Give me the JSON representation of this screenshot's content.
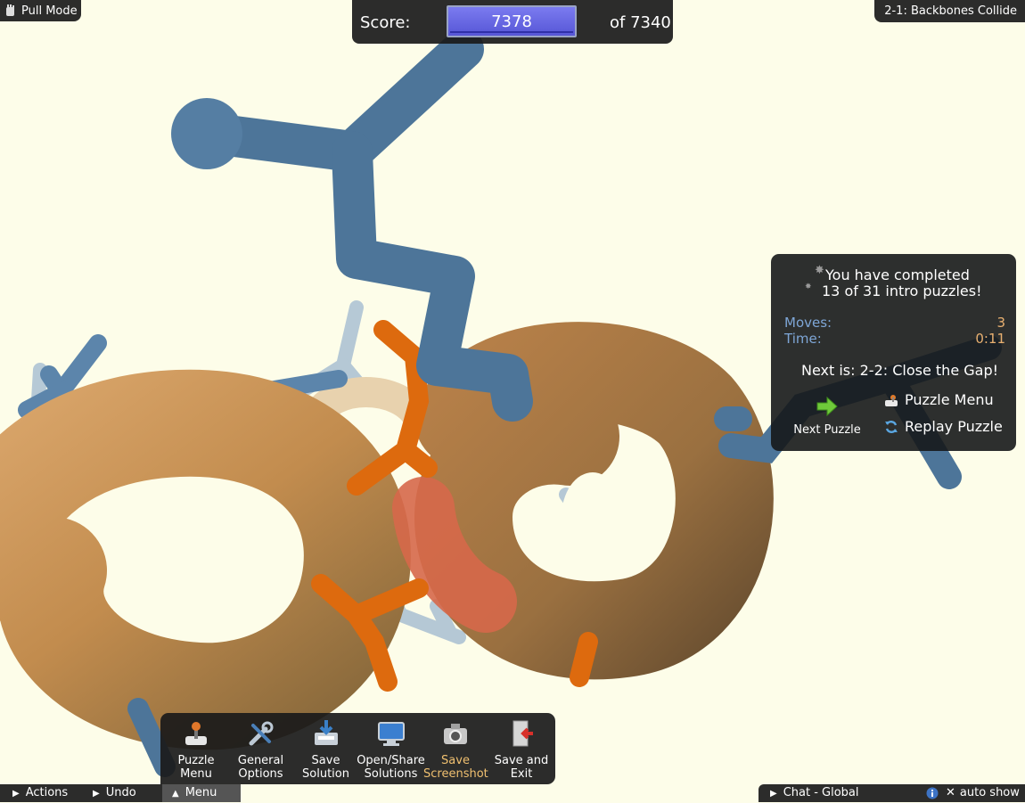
{
  "pull_mode": {
    "label": "Pull Mode",
    "icon": "hand-icon"
  },
  "score": {
    "label": "Score:",
    "value": "7378",
    "target": "of 7340"
  },
  "puzzle_title": "2-1: Backbones Collide",
  "completion": {
    "line1": "You have completed",
    "line2": "13 of 31 intro puzzles!",
    "moves_label": "Moves:",
    "moves_value": "3",
    "time_label": "Time:",
    "time_value": "0:11",
    "next_is": "Next is: 2-2: Close the Gap!",
    "next_puzzle_label": "Next Puzzle",
    "puzzle_menu_label": "Puzzle Menu",
    "replay_label": "Replay Puzzle"
  },
  "toolbar": [
    {
      "line1": "Puzzle",
      "line2": "Menu",
      "icon": "joystick-icon"
    },
    {
      "line1": "General",
      "line2": "Options",
      "icon": "tools-icon"
    },
    {
      "line1": "Save",
      "line2": "Solution",
      "icon": "save-icon"
    },
    {
      "line1": "Open/Share",
      "line2": "Solutions",
      "icon": "monitor-icon"
    },
    {
      "line1": "Save",
      "line2": "Screenshot",
      "icon": "camera-icon"
    },
    {
      "line1": "Save and",
      "line2": "Exit",
      "icon": "exit-door-icon"
    }
  ],
  "bottom_bar": {
    "actions": "Actions",
    "undo": "Undo",
    "menu": "Menu",
    "chat": "Chat - Global",
    "auto_show": "auto show"
  },
  "colors": {
    "background": "#fdfde9",
    "backbone_blue": "#4d7599",
    "sidechain_orange": "#dd6a0e",
    "helix_tan": "#c79758",
    "score_box": "#6b6be6",
    "stat_label": "#7ea6d6",
    "stat_value": "#e8b070",
    "highlight_text": "#f0c070"
  }
}
